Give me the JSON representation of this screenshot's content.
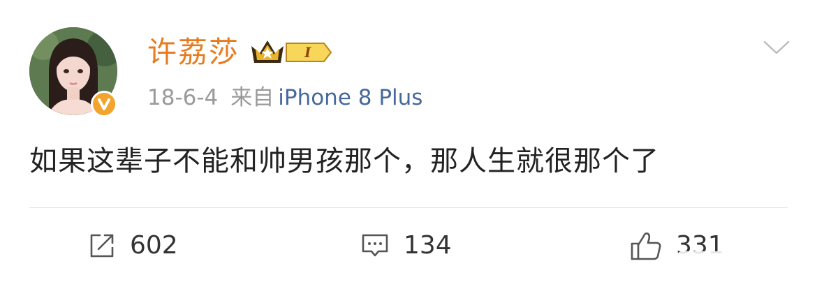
{
  "post": {
    "username": "许荔莎",
    "vip_level": "I",
    "date": "18-6-4",
    "source_prefix": "来自",
    "source_device": "iPhone 8 Plus",
    "content": "如果这辈子不能和帅男孩那个，那人生就很那个了",
    "verified_badge_icon": "v-verified-icon",
    "menu_icon": "chevron-down-icon"
  },
  "actions": {
    "repost": {
      "icon": "repost-icon",
      "count": "602"
    },
    "comment": {
      "icon": "comment-icon",
      "count": "134"
    },
    "like": {
      "icon": "thumbs-up-icon",
      "count": "331"
    }
  },
  "colors": {
    "username": "#e77b1f",
    "source_device": "#45699a",
    "meta": "#9a9a9a",
    "verified_badge": "#f3a42d"
  }
}
